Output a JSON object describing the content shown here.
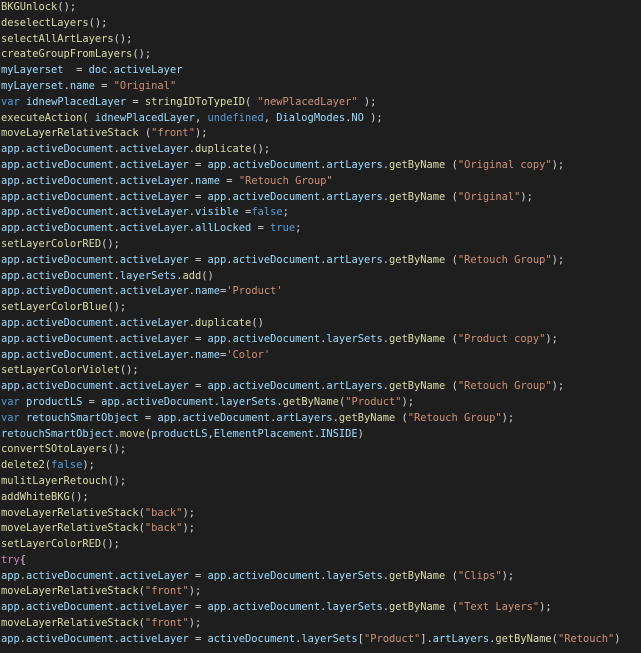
{
  "editor": {
    "theme_colors": {
      "background": "#1e1e1e",
      "function": "#dcdcaa",
      "variable": "#9cdcfe",
      "string": "#ce9178",
      "keyword": "#569cd6",
      "control": "#c586c0",
      "plain": "#d4d4d4"
    },
    "lines": [
      [
        [
          "BKGUnlock",
          "fn"
        ],
        [
          "();",
          "plain"
        ]
      ],
      [
        [
          "deselectLayers",
          "fn"
        ],
        [
          "();",
          "plain"
        ]
      ],
      [
        [
          "selectAllArtLayers",
          "fn"
        ],
        [
          "();",
          "plain"
        ]
      ],
      [
        [
          "createGroupFromLayers",
          "fn"
        ],
        [
          "();",
          "plain"
        ]
      ],
      [
        [
          "myLayerset",
          "var"
        ],
        [
          "  = ",
          "plain"
        ],
        [
          "doc",
          "var"
        ],
        [
          ".",
          "plain"
        ],
        [
          "activeLayer",
          "var"
        ]
      ],
      [
        [
          "myLayerset",
          "var"
        ],
        [
          ".",
          "plain"
        ],
        [
          "name",
          "var"
        ],
        [
          " = ",
          "plain"
        ],
        [
          "\"Original\"",
          "str"
        ]
      ],
      [
        [
          "var",
          "kw"
        ],
        [
          " ",
          "plain"
        ],
        [
          "idnewPlacedLayer",
          "var"
        ],
        [
          " = ",
          "plain"
        ],
        [
          "stringIDToTypeID",
          "fn"
        ],
        [
          "( ",
          "plain"
        ],
        [
          "\"newPlacedLayer\"",
          "str"
        ],
        [
          " );",
          "plain"
        ]
      ],
      [
        [
          "executeAction",
          "fn"
        ],
        [
          "( ",
          "plain"
        ],
        [
          "idnewPlacedLayer",
          "var"
        ],
        [
          ", ",
          "plain"
        ],
        [
          "undefined",
          "kw"
        ],
        [
          ", ",
          "plain"
        ],
        [
          "DialogModes",
          "var"
        ],
        [
          ".",
          "plain"
        ],
        [
          "NO",
          "var"
        ],
        [
          " );",
          "plain"
        ]
      ],
      [
        [
          "moveLayerRelativeStack",
          "fn"
        ],
        [
          " (",
          "plain"
        ],
        [
          "\"front\"",
          "str"
        ],
        [
          ");",
          "plain"
        ]
      ],
      [
        [
          "app",
          "var"
        ],
        [
          ".",
          "plain"
        ],
        [
          "activeDocument",
          "var"
        ],
        [
          ".",
          "plain"
        ],
        [
          "activeLayer",
          "var"
        ],
        [
          ".",
          "plain"
        ],
        [
          "duplicate",
          "fn"
        ],
        [
          "();",
          "plain"
        ]
      ],
      [
        [
          "app",
          "var"
        ],
        [
          ".",
          "plain"
        ],
        [
          "activeDocument",
          "var"
        ],
        [
          ".",
          "plain"
        ],
        [
          "activeLayer",
          "var"
        ],
        [
          " = ",
          "plain"
        ],
        [
          "app",
          "var"
        ],
        [
          ".",
          "plain"
        ],
        [
          "activeDocument",
          "var"
        ],
        [
          ".",
          "plain"
        ],
        [
          "artLayers",
          "var"
        ],
        [
          ".",
          "plain"
        ],
        [
          "getByName",
          "fn"
        ],
        [
          " (",
          "plain"
        ],
        [
          "\"Original copy\"",
          "str"
        ],
        [
          ");",
          "plain"
        ]
      ],
      [
        [
          "app",
          "var"
        ],
        [
          ".",
          "plain"
        ],
        [
          "activeDocument",
          "var"
        ],
        [
          ".",
          "plain"
        ],
        [
          "activeLayer",
          "var"
        ],
        [
          ".",
          "plain"
        ],
        [
          "name",
          "var"
        ],
        [
          " = ",
          "plain"
        ],
        [
          "\"Retouch Group\"",
          "str"
        ]
      ],
      [
        [
          "app",
          "var"
        ],
        [
          ".",
          "plain"
        ],
        [
          "activeDocument",
          "var"
        ],
        [
          ".",
          "plain"
        ],
        [
          "activeLayer",
          "var"
        ],
        [
          " = ",
          "plain"
        ],
        [
          "app",
          "var"
        ],
        [
          ".",
          "plain"
        ],
        [
          "activeDocument",
          "var"
        ],
        [
          ".",
          "plain"
        ],
        [
          "artLayers",
          "var"
        ],
        [
          ".",
          "plain"
        ],
        [
          "getByName",
          "fn"
        ],
        [
          " (",
          "plain"
        ],
        [
          "\"Original\"",
          "str"
        ],
        [
          ");",
          "plain"
        ]
      ],
      [
        [
          "app",
          "var"
        ],
        [
          ".",
          "plain"
        ],
        [
          "activeDocument",
          "var"
        ],
        [
          ".",
          "plain"
        ],
        [
          "activeLayer",
          "var"
        ],
        [
          ".",
          "plain"
        ],
        [
          "visible",
          "var"
        ],
        [
          " =",
          "plain"
        ],
        [
          "false",
          "kw"
        ],
        [
          ";",
          "plain"
        ]
      ],
      [
        [
          "app",
          "var"
        ],
        [
          ".",
          "plain"
        ],
        [
          "activeDocument",
          "var"
        ],
        [
          ".",
          "plain"
        ],
        [
          "activeLayer",
          "var"
        ],
        [
          ".",
          "plain"
        ],
        [
          "allLocked",
          "var"
        ],
        [
          " = ",
          "plain"
        ],
        [
          "true",
          "kw"
        ],
        [
          ";",
          "plain"
        ]
      ],
      [
        [
          "setLayerColorRED",
          "fn"
        ],
        [
          "();",
          "plain"
        ]
      ],
      [
        [
          "app",
          "var"
        ],
        [
          ".",
          "plain"
        ],
        [
          "activeDocument",
          "var"
        ],
        [
          ".",
          "plain"
        ],
        [
          "activeLayer",
          "var"
        ],
        [
          " = ",
          "plain"
        ],
        [
          "app",
          "var"
        ],
        [
          ".",
          "plain"
        ],
        [
          "activeDocument",
          "var"
        ],
        [
          ".",
          "plain"
        ],
        [
          "artLayers",
          "var"
        ],
        [
          ".",
          "plain"
        ],
        [
          "getByName",
          "fn"
        ],
        [
          " (",
          "plain"
        ],
        [
          "\"Retouch Group\"",
          "str"
        ],
        [
          ");",
          "plain"
        ]
      ],
      [
        [
          "app",
          "var"
        ],
        [
          ".",
          "plain"
        ],
        [
          "activeDocument",
          "var"
        ],
        [
          ".",
          "plain"
        ],
        [
          "layerSets",
          "var"
        ],
        [
          ".",
          "plain"
        ],
        [
          "add",
          "fn"
        ],
        [
          "()",
          "plain"
        ]
      ],
      [
        [
          "app",
          "var"
        ],
        [
          ".",
          "plain"
        ],
        [
          "activeDocument",
          "var"
        ],
        [
          ".",
          "plain"
        ],
        [
          "activeLayer",
          "var"
        ],
        [
          ".",
          "plain"
        ],
        [
          "name",
          "var"
        ],
        [
          "=",
          "plain"
        ],
        [
          "'Product'",
          "str"
        ]
      ],
      [
        [
          "setLayerColorBlue",
          "fn"
        ],
        [
          "();",
          "plain"
        ]
      ],
      [
        [
          "app",
          "var"
        ],
        [
          ".",
          "plain"
        ],
        [
          "activeDocument",
          "var"
        ],
        [
          ".",
          "plain"
        ],
        [
          "activeLayer",
          "var"
        ],
        [
          ".",
          "plain"
        ],
        [
          "duplicate",
          "fn"
        ],
        [
          "()",
          "plain"
        ]
      ],
      [
        [
          "app",
          "var"
        ],
        [
          ".",
          "plain"
        ],
        [
          "activeDocument",
          "var"
        ],
        [
          ".",
          "plain"
        ],
        [
          "activeLayer",
          "var"
        ],
        [
          " = ",
          "plain"
        ],
        [
          "app",
          "var"
        ],
        [
          ".",
          "plain"
        ],
        [
          "activeDocument",
          "var"
        ],
        [
          ".",
          "plain"
        ],
        [
          "layerSets",
          "var"
        ],
        [
          ".",
          "plain"
        ],
        [
          "getByName",
          "fn"
        ],
        [
          " (",
          "plain"
        ],
        [
          "\"Product copy\"",
          "str"
        ],
        [
          ");",
          "plain"
        ]
      ],
      [
        [
          "app",
          "var"
        ],
        [
          ".",
          "plain"
        ],
        [
          "activeDocument",
          "var"
        ],
        [
          ".",
          "plain"
        ],
        [
          "activeLayer",
          "var"
        ],
        [
          ".",
          "plain"
        ],
        [
          "name",
          "var"
        ],
        [
          "=",
          "plain"
        ],
        [
          "'Color'",
          "str"
        ]
      ],
      [
        [
          "setLayerColorViolet",
          "fn"
        ],
        [
          "();",
          "plain"
        ]
      ],
      [
        [
          "app",
          "var"
        ],
        [
          ".",
          "plain"
        ],
        [
          "activeDocument",
          "var"
        ],
        [
          ".",
          "plain"
        ],
        [
          "activeLayer",
          "var"
        ],
        [
          " = ",
          "plain"
        ],
        [
          "app",
          "var"
        ],
        [
          ".",
          "plain"
        ],
        [
          "activeDocument",
          "var"
        ],
        [
          ".",
          "plain"
        ],
        [
          "artLayers",
          "var"
        ],
        [
          ".",
          "plain"
        ],
        [
          "getByName",
          "fn"
        ],
        [
          " (",
          "plain"
        ],
        [
          "\"Retouch Group\"",
          "str"
        ],
        [
          ");",
          "plain"
        ]
      ],
      [
        [
          "var",
          "kw"
        ],
        [
          " ",
          "plain"
        ],
        [
          "productLS",
          "var"
        ],
        [
          " = ",
          "plain"
        ],
        [
          "app",
          "var"
        ],
        [
          ".",
          "plain"
        ],
        [
          "activeDocument",
          "var"
        ],
        [
          ".",
          "plain"
        ],
        [
          "layerSets",
          "var"
        ],
        [
          ".",
          "plain"
        ],
        [
          "getByName",
          "fn"
        ],
        [
          "(",
          "plain"
        ],
        [
          "\"Product\"",
          "str"
        ],
        [
          ");",
          "plain"
        ]
      ],
      [
        [
          "var",
          "kw"
        ],
        [
          " ",
          "plain"
        ],
        [
          "retouchSmartObject",
          "var"
        ],
        [
          " = ",
          "plain"
        ],
        [
          "app",
          "var"
        ],
        [
          ".",
          "plain"
        ],
        [
          "activeDocument",
          "var"
        ],
        [
          ".",
          "plain"
        ],
        [
          "artLayers",
          "var"
        ],
        [
          ".",
          "plain"
        ],
        [
          "getByName",
          "fn"
        ],
        [
          " (",
          "plain"
        ],
        [
          "\"Retouch Group\"",
          "str"
        ],
        [
          ");",
          "plain"
        ]
      ],
      [
        [
          "retouchSmartObject",
          "var"
        ],
        [
          ".",
          "plain"
        ],
        [
          "move",
          "fn"
        ],
        [
          "(",
          "plain"
        ],
        [
          "productLS",
          "var"
        ],
        [
          ",",
          "plain"
        ],
        [
          "ElementPlacement",
          "var"
        ],
        [
          ".",
          "plain"
        ],
        [
          "INSIDE",
          "var"
        ],
        [
          ")",
          "plain"
        ]
      ],
      [
        [
          "convertSOtoLayers",
          "fn"
        ],
        [
          "();",
          "plain"
        ]
      ],
      [
        [
          "delete2",
          "fn"
        ],
        [
          "(",
          "plain"
        ],
        [
          "false",
          "kw"
        ],
        [
          ");",
          "plain"
        ]
      ],
      [
        [
          "mulitLayerRetouch",
          "fn"
        ],
        [
          "();",
          "plain"
        ]
      ],
      [
        [
          "addWhiteBKG",
          "fn"
        ],
        [
          "();",
          "plain"
        ]
      ],
      [
        [
          "moveLayerRelativeStack",
          "fn"
        ],
        [
          "(",
          "plain"
        ],
        [
          "\"back\"",
          "str"
        ],
        [
          ");",
          "plain"
        ]
      ],
      [
        [
          "moveLayerRelativeStack",
          "fn"
        ],
        [
          "(",
          "plain"
        ],
        [
          "\"back\"",
          "str"
        ],
        [
          ");",
          "plain"
        ]
      ],
      [
        [
          "setLayerColorRED",
          "fn"
        ],
        [
          "();",
          "plain"
        ]
      ],
      [
        [
          "try",
          "ctl"
        ],
        [
          "{",
          "plain"
        ]
      ],
      [
        [
          "app",
          "var"
        ],
        [
          ".",
          "plain"
        ],
        [
          "activeDocument",
          "var"
        ],
        [
          ".",
          "plain"
        ],
        [
          "activeLayer",
          "var"
        ],
        [
          " = ",
          "plain"
        ],
        [
          "app",
          "var"
        ],
        [
          ".",
          "plain"
        ],
        [
          "activeDocument",
          "var"
        ],
        [
          ".",
          "plain"
        ],
        [
          "layerSets",
          "var"
        ],
        [
          ".",
          "plain"
        ],
        [
          "getByName",
          "fn"
        ],
        [
          " (",
          "plain"
        ],
        [
          "\"Clips\"",
          "str"
        ],
        [
          ");",
          "plain"
        ]
      ],
      [
        [
          "moveLayerRelativeStack",
          "fn"
        ],
        [
          "(",
          "plain"
        ],
        [
          "\"front\"",
          "str"
        ],
        [
          ");",
          "plain"
        ]
      ],
      [
        [
          "app",
          "var"
        ],
        [
          ".",
          "plain"
        ],
        [
          "activeDocument",
          "var"
        ],
        [
          ".",
          "plain"
        ],
        [
          "activeLayer",
          "var"
        ],
        [
          " = ",
          "plain"
        ],
        [
          "app",
          "var"
        ],
        [
          ".",
          "plain"
        ],
        [
          "activeDocument",
          "var"
        ],
        [
          ".",
          "plain"
        ],
        [
          "layerSets",
          "var"
        ],
        [
          ".",
          "plain"
        ],
        [
          "getByName",
          "fn"
        ],
        [
          " (",
          "plain"
        ],
        [
          "\"Text Layers\"",
          "str"
        ],
        [
          ");",
          "plain"
        ]
      ],
      [
        [
          "moveLayerRelativeStack",
          "fn"
        ],
        [
          "(",
          "plain"
        ],
        [
          "\"front\"",
          "str"
        ],
        [
          ");",
          "plain"
        ]
      ],
      [
        [
          "app",
          "var"
        ],
        [
          ".",
          "plain"
        ],
        [
          "activeDocument",
          "var"
        ],
        [
          ".",
          "plain"
        ],
        [
          "activeLayer",
          "var"
        ],
        [
          " = ",
          "plain"
        ],
        [
          "activeDocument",
          "var"
        ],
        [
          ".",
          "plain"
        ],
        [
          "layerSets",
          "var"
        ],
        [
          "[",
          "plain"
        ],
        [
          "\"Product\"",
          "str"
        ],
        [
          "].",
          "plain"
        ],
        [
          "artLayers",
          "var"
        ],
        [
          ".",
          "plain"
        ],
        [
          "getByName",
          "fn"
        ],
        [
          "(",
          "plain"
        ],
        [
          "\"Retouch\"",
          "str"
        ],
        [
          ")",
          "plain"
        ]
      ]
    ]
  }
}
